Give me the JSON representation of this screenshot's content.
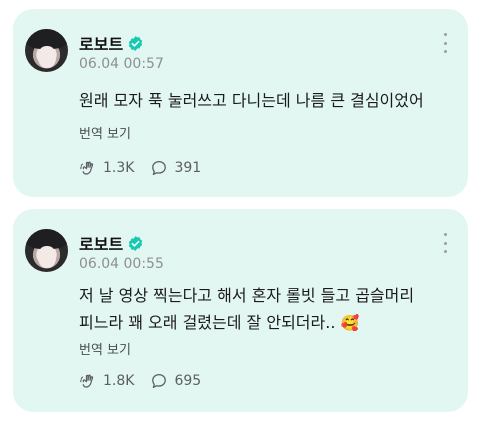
{
  "posts": [
    {
      "author": "로보트",
      "time": "06.04 00:57",
      "text": "원래 모자 푹 눌러쓰고 다니는데 나름 큰 결심이었어",
      "translate_label": "번역 보기",
      "likes": "1.3K",
      "comments": "391"
    },
    {
      "author": "로보트",
      "time": "06.04 00:55",
      "text": "저 날 영상 찍는다고 해서 혼자 롤빗 들고 곱슬머리\n피느라 꽤 오래 걸렸는데 잘 안되더라..",
      "emoji": "🥰",
      "translate_label": "번역 보기",
      "likes": "1.8K",
      "comments": "695"
    }
  ],
  "colors": {
    "card_bg": "#e3f7f2",
    "verified_badge": "#16c9b3",
    "muted_text": "#8d8f93"
  }
}
